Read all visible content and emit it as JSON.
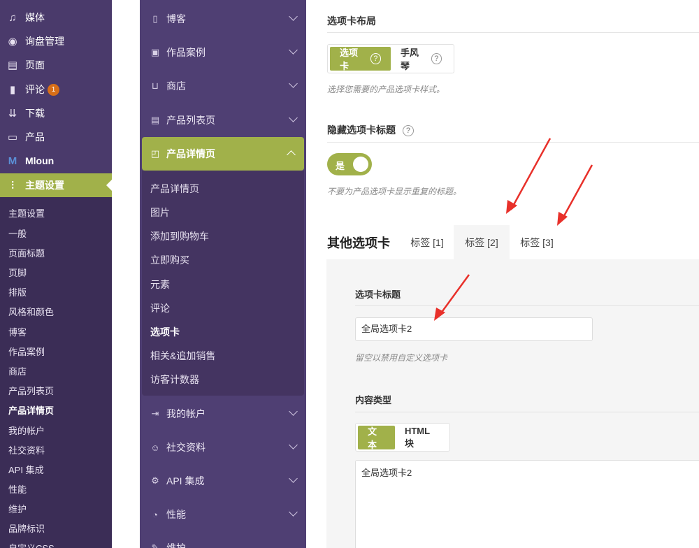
{
  "wp_menu": {
    "items": [
      {
        "label": "媒体",
        "icon": "media-icon",
        "glyph": "♫"
      },
      {
        "label": "询盘管理",
        "icon": "inquiry-icon",
        "glyph": "◉"
      },
      {
        "label": "页面",
        "icon": "pages-icon",
        "glyph": "▤"
      },
      {
        "label": "评论",
        "icon": "comments-icon",
        "glyph": "▮",
        "badge": "1"
      },
      {
        "label": "下载",
        "icon": "download-icon",
        "glyph": "⇊"
      },
      {
        "label": "产品",
        "icon": "products-icon",
        "glyph": "▭"
      },
      {
        "label": "Mloun",
        "icon": "mloun-logo-icon",
        "glyph": "M"
      },
      {
        "label": "主题设置",
        "icon": "theme-settings-icon",
        "glyph": "⫶",
        "active": true
      }
    ],
    "submenu": [
      "主题设置",
      "一般",
      "页面标题",
      "页脚",
      "排版",
      "风格和颜色",
      "博客",
      "作品案例",
      "商店",
      "产品列表页",
      "产品详情页",
      "我的帐户",
      "社交资料",
      "API 集成",
      "性能",
      "维护",
      "品牌标识",
      "自定义CSS"
    ],
    "submenu_current": "产品详情页"
  },
  "options_nav": {
    "items_top": [
      {
        "label": "博客",
        "icon": "blog-icon",
        "glyph": "▯"
      },
      {
        "label": "作品案例",
        "icon": "portfolio-icon",
        "glyph": "▣"
      },
      {
        "label": "商店",
        "icon": "cart-icon",
        "glyph": "⊔"
      },
      {
        "label": "产品列表页",
        "icon": "archive-icon",
        "glyph": "▤"
      }
    ],
    "open_item": {
      "label": "产品详情页",
      "icon": "bag-icon",
      "glyph": "◰"
    },
    "open_subitems": [
      "产品详情页",
      "图片",
      "添加到购物车",
      "立即购买",
      "元素",
      "评论",
      "选项卡",
      "相关&追加销售",
      "访客计数器"
    ],
    "open_current": "选项卡",
    "items_bottom": [
      {
        "label": "我的帐户",
        "icon": "login-icon",
        "glyph": "⇥"
      },
      {
        "label": "社交资料",
        "icon": "users-icon",
        "glyph": "☺"
      },
      {
        "label": "API 集成",
        "icon": "gear-icon",
        "glyph": "⚙"
      },
      {
        "label": "性能",
        "icon": "gauge-icon",
        "glyph": "◔"
      },
      {
        "label": "维护",
        "icon": "wrench-icon",
        "glyph": "✎"
      }
    ]
  },
  "main": {
    "tabs_layout": {
      "title": "选项卡布局",
      "options": [
        "选项卡",
        "手风琴"
      ],
      "selected": "选项卡",
      "description": "选择您需要的产品选项卡样式。"
    },
    "hide_titles": {
      "title": "隐藏选项卡标题",
      "toggle_label": "是",
      "description": "不要为产品选项卡显示重复的标题。"
    },
    "other_tabs": {
      "title": "其他选项卡",
      "tabs": [
        "标签 [1]",
        "标签 [2]",
        "标签 [3]"
      ],
      "active_tab": "标签 [2]",
      "tab_title_label": "选项卡标题",
      "tab_title_value": "全局选项卡2",
      "tab_title_desc": "留空以禁用自定义选项卡",
      "content_type_label": "内容类型",
      "content_type_options": [
        "文本",
        "HTML块"
      ],
      "content_type_selected": "文本",
      "content_value": "全局选项卡2"
    },
    "help_glyph": "?"
  },
  "colors": {
    "accent": "#a1b14a",
    "wp_sidebar": "#4a3a6b",
    "options_sidebar": "#4f3f73",
    "badge": "#d86e18",
    "annotation_arrow": "#e8302a"
  }
}
